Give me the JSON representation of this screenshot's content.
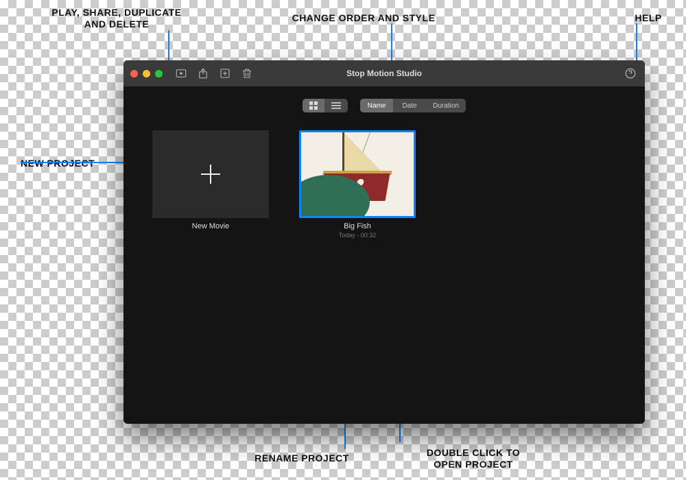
{
  "annotations": {
    "play_share": "PLAY, SHARE, DUPLICATE\nAND DELETE",
    "change_order": "CHANGE ORDER AND STYLE",
    "help": "HELP",
    "new_project": "NEW PROJECT",
    "rename": "RENAME PROJECT",
    "open": "DOUBLE CLICK TO\nOPEN PROJECT"
  },
  "window": {
    "title": "Stop Motion Studio"
  },
  "sort_options": {
    "name": "Name",
    "date": "Date",
    "duration": "Duration"
  },
  "projects": {
    "new_label": "New Movie",
    "item": {
      "title": "Big Fish",
      "subtitle": "Today - 00:32"
    }
  }
}
